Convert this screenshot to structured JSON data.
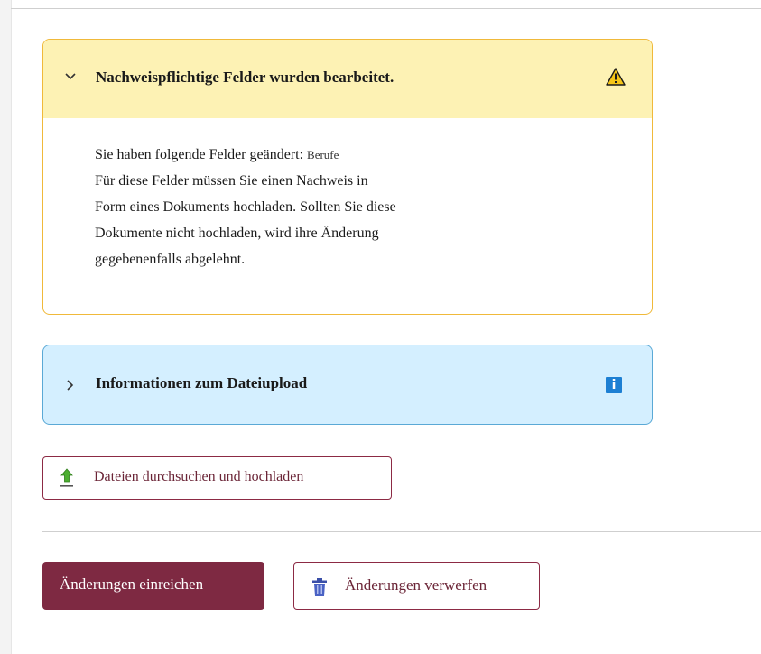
{
  "warning_panel": {
    "title": "Nachweispflichtige Felder wurden bearbeitet.",
    "icon": "warning-icon",
    "expanded": true,
    "body": {
      "changed_prefix": "Sie haben folgende Felder geändert:",
      "changed_fields": "Berufe",
      "line2": "Für diese Felder müssen Sie einen Nachweis in",
      "line3": "Form eines Dokuments hochladen. Sollten Sie diese",
      "line4": "Dokumente nicht hochladen, wird ihre Änderung",
      "line5": "gegebenenfalls abgelehnt."
    },
    "colors": {
      "header_bg": "#fdf2b4",
      "border": "#f0b93a",
      "icon_fill": "#f5c518"
    }
  },
  "info_panel": {
    "title": "Informationen zum Dateiupload",
    "icon": "info-icon",
    "icon_glyph": "i",
    "expanded": false,
    "colors": {
      "bg": "#d4efff",
      "border": "#5aa9d6",
      "icon_bg": "#1d7fd3"
    }
  },
  "upload": {
    "label": "Dateien durchsuchen und hochladen",
    "icon": "upload-arrow-icon"
  },
  "actions": {
    "submit_label": "Änderungen einreichen",
    "discard_label": "Änderungen verwerfen",
    "discard_icon": "trash-icon"
  },
  "colors": {
    "brand": "#7e2942",
    "brand_text": "#6b2537"
  }
}
